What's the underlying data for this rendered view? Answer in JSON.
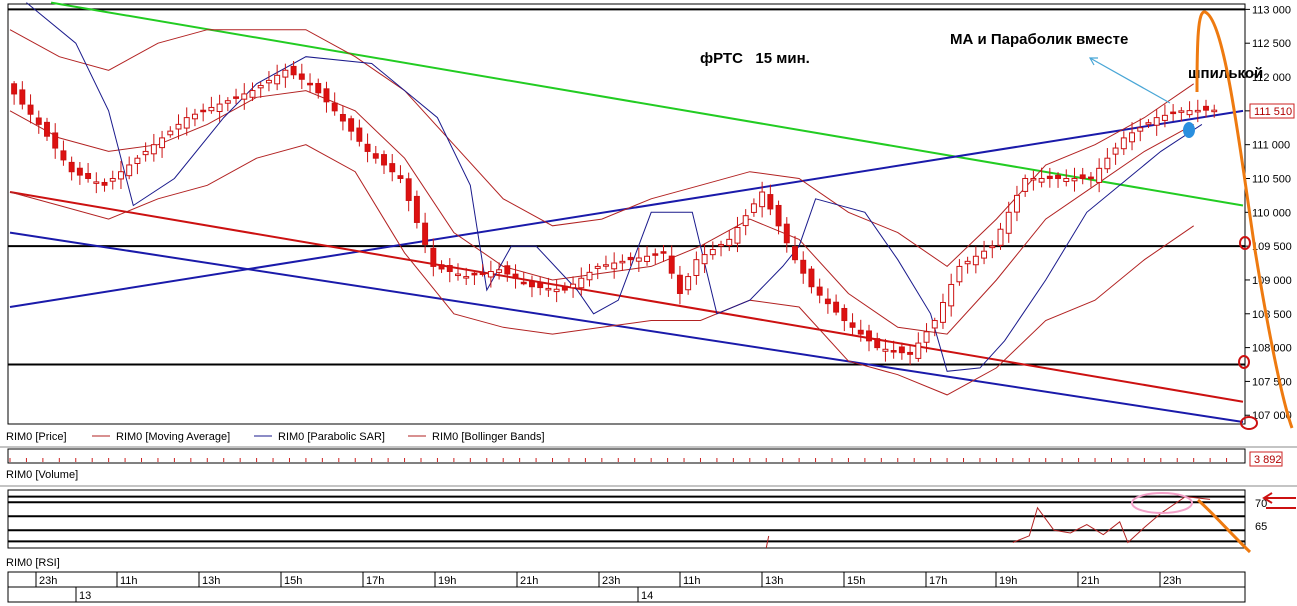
{
  "annotations": {
    "title": "фРТС   15 мин.",
    "note_ma_sar": "МА и Параболик вместе",
    "note_spike": "шпилькой"
  },
  "price_panel": {
    "legend": [
      {
        "label": "RIM0 [Price]",
        "color": "#000000"
      },
      {
        "label": "RIM0 [Moving Average]",
        "color": "#b22222"
      },
      {
        "label": "RIM0 [Parabolic SAR]",
        "color": "#1a1a8c"
      },
      {
        "label": "RIM0 [Bollinger Bands]",
        "color": "#b22222"
      }
    ],
    "last_price_label": "111 510"
  },
  "volume_panel": {
    "label": "RIM0 [Volume]",
    "last_value_label": "3 892"
  },
  "rsi_panel": {
    "label": "RIM0 [RSI]",
    "level_labels": [
      "70",
      "65"
    ]
  },
  "time_axis": {
    "hour_labels": [
      "23h",
      "11h",
      "13h",
      "15h",
      "17h",
      "19h",
      "21h",
      "23h",
      "11h",
      "13h",
      "15h",
      "17h",
      "19h",
      "21h",
      "23h"
    ],
    "day_labels": [
      "13",
      "14"
    ]
  },
  "chart_data": {
    "type": "line",
    "title": "фРТС   15 мин.",
    "ylim": [
      106900,
      113050
    ],
    "y_ticks": [
      107000,
      107500,
      108000,
      108500,
      109000,
      109500,
      110000,
      110500,
      111000,
      111500,
      112000,
      112500,
      113000
    ],
    "y_tick_labels": [
      "107 000",
      "107 500",
      "108 000",
      "108 500",
      "109 000",
      "109 500",
      "110 000",
      "110 500",
      "111 000",
      "111 500",
      "112 000",
      "112 500",
      "113 000"
    ],
    "x_count": 150,
    "horizontal_levels": [
      113000,
      109500,
      107750
    ],
    "trend_lines": [
      {
        "name": "green",
        "color": "#22cc22",
        "from": [
          5,
          113100
        ],
        "to": [
          150,
          110100
        ]
      },
      {
        "name": "blue-upper",
        "color": "#1a1aaa",
        "from": [
          0,
          108600
        ],
        "to": [
          150,
          111500
        ]
      },
      {
        "name": "red",
        "color": "#cc1111",
        "from": [
          0,
          110300
        ],
        "to": [
          150,
          107200
        ]
      },
      {
        "name": "blue-lower",
        "color": "#1a1aaa",
        "from": [
          0,
          109700
        ],
        "to": [
          150,
          106900
        ]
      }
    ],
    "series": [
      {
        "name": "RIM0 [Price]",
        "candle_anchors": [
          [
            0,
            111900
          ],
          [
            4,
            111300
          ],
          [
            8,
            110600
          ],
          [
            12,
            110400
          ],
          [
            14,
            110600
          ],
          [
            18,
            111000
          ],
          [
            22,
            111400
          ],
          [
            26,
            111600
          ],
          [
            30,
            111800
          ],
          [
            34,
            112100
          ],
          [
            37,
            111900
          ],
          [
            40,
            111500
          ],
          [
            44,
            110900
          ],
          [
            48,
            110500
          ],
          [
            52,
            109200
          ],
          [
            56,
            109050
          ],
          [
            60,
            109150
          ],
          [
            64,
            108900
          ],
          [
            68,
            108850
          ],
          [
            72,
            109200
          ],
          [
            76,
            109300
          ],
          [
            80,
            109400
          ],
          [
            82,
            108800
          ],
          [
            84,
            109300
          ],
          [
            88,
            109600
          ],
          [
            92,
            110300
          ],
          [
            96,
            109300
          ],
          [
            98,
            108900
          ],
          [
            102,
            108400
          ],
          [
            106,
            108000
          ],
          [
            110,
            107900
          ],
          [
            113,
            108400
          ],
          [
            116,
            109200
          ],
          [
            120,
            109500
          ],
          [
            124,
            110500
          ],
          [
            128,
            110500
          ],
          [
            132,
            110500
          ],
          [
            136,
            111100
          ],
          [
            140,
            111400
          ],
          [
            143,
            111500
          ],
          [
            146,
            111510
          ]
        ]
      },
      {
        "name": "RIM0 [Parabolic SAR]",
        "points": [
          [
            2,
            113100
          ],
          [
            8,
            112500
          ],
          [
            12,
            111500
          ],
          [
            15,
            110100
          ],
          [
            20,
            110500
          ],
          [
            26,
            111400
          ],
          [
            30,
            111900
          ],
          [
            36,
            112300
          ],
          [
            44,
            112200
          ],
          [
            52,
            111400
          ],
          [
            56,
            110400
          ],
          [
            58,
            108850
          ],
          [
            61,
            109500
          ],
          [
            64,
            109500
          ],
          [
            69,
            108850
          ],
          [
            71,
            108500
          ],
          [
            74,
            108700
          ],
          [
            78,
            110000
          ],
          [
            83,
            110000
          ],
          [
            86,
            108500
          ],
          [
            90,
            108700
          ],
          [
            94,
            109200
          ],
          [
            96,
            109500
          ],
          [
            98,
            110200
          ],
          [
            104,
            110000
          ],
          [
            108,
            109300
          ],
          [
            112,
            108500
          ],
          [
            114,
            107650
          ],
          [
            118,
            107700
          ],
          [
            121,
            108100
          ],
          [
            126,
            109000
          ],
          [
            131,
            110000
          ],
          [
            136,
            110500
          ],
          [
            140,
            110900
          ],
          [
            145,
            111300
          ]
        ]
      },
      {
        "name": "RIM0 [Moving Average]",
        "points": [
          [
            0,
            111500
          ],
          [
            6,
            111100
          ],
          [
            12,
            110900
          ],
          [
            18,
            111000
          ],
          [
            24,
            111300
          ],
          [
            30,
            111700
          ],
          [
            36,
            111800
          ],
          [
            42,
            111500
          ],
          [
            48,
            110800
          ],
          [
            54,
            109700
          ],
          [
            60,
            109200
          ],
          [
            66,
            109000
          ],
          [
            72,
            109100
          ],
          [
            78,
            109200
          ],
          [
            84,
            109500
          ],
          [
            90,
            109900
          ],
          [
            96,
            109600
          ],
          [
            102,
            108800
          ],
          [
            108,
            108300
          ],
          [
            114,
            108200
          ],
          [
            120,
            109000
          ],
          [
            126,
            109900
          ],
          [
            132,
            110400
          ],
          [
            138,
            110900
          ],
          [
            144,
            111300
          ]
        ]
      },
      {
        "name": "RIM0 [Bollinger Bands] upper",
        "points": [
          [
            0,
            112700
          ],
          [
            6,
            112300
          ],
          [
            12,
            112100
          ],
          [
            18,
            112500
          ],
          [
            24,
            112700
          ],
          [
            30,
            112700
          ],
          [
            36,
            112700
          ],
          [
            42,
            112300
          ],
          [
            48,
            111800
          ],
          [
            54,
            111000
          ],
          [
            60,
            110200
          ],
          [
            66,
            109800
          ],
          [
            72,
            109900
          ],
          [
            78,
            110200
          ],
          [
            84,
            110400
          ],
          [
            90,
            110600
          ],
          [
            96,
            110500
          ],
          [
            102,
            110000
          ],
          [
            108,
            109700
          ],
          [
            114,
            109200
          ],
          [
            120,
            109900
          ],
          [
            126,
            110700
          ],
          [
            132,
            111000
          ],
          [
            138,
            111400
          ],
          [
            144,
            111900
          ]
        ]
      },
      {
        "name": "RIM0 [Bollinger Bands] lower",
        "points": [
          [
            0,
            110300
          ],
          [
            6,
            110100
          ],
          [
            12,
            109900
          ],
          [
            18,
            110200
          ],
          [
            24,
            110400
          ],
          [
            30,
            110800
          ],
          [
            36,
            111000
          ],
          [
            42,
            110600
          ],
          [
            48,
            109400
          ],
          [
            54,
            108500
          ],
          [
            60,
            108300
          ],
          [
            66,
            108200
          ],
          [
            72,
            108300
          ],
          [
            78,
            108400
          ],
          [
            84,
            108400
          ],
          [
            90,
            108700
          ],
          [
            96,
            108600
          ],
          [
            102,
            107800
          ],
          [
            108,
            107600
          ],
          [
            114,
            107300
          ],
          [
            120,
            107700
          ],
          [
            126,
            108400
          ],
          [
            132,
            108700
          ],
          [
            138,
            109300
          ],
          [
            144,
            109800
          ]
        ]
      }
    ],
    "rsi": {
      "levels": [
        71,
        70,
        67.5,
        65,
        63
      ],
      "ylim": [
        62,
        72
      ],
      "points": [
        [
          122,
          62.8
        ],
        [
          124,
          64
        ],
        [
          125,
          69
        ],
        [
          127,
          65
        ],
        [
          129,
          64.5
        ],
        [
          131,
          66
        ],
        [
          133,
          64.2
        ],
        [
          135,
          66.5
        ],
        [
          136,
          62.8
        ],
        [
          138,
          65.5
        ],
        [
          140,
          68
        ],
        [
          143,
          71
        ],
        [
          146,
          70.5
        ]
      ]
    }
  }
}
